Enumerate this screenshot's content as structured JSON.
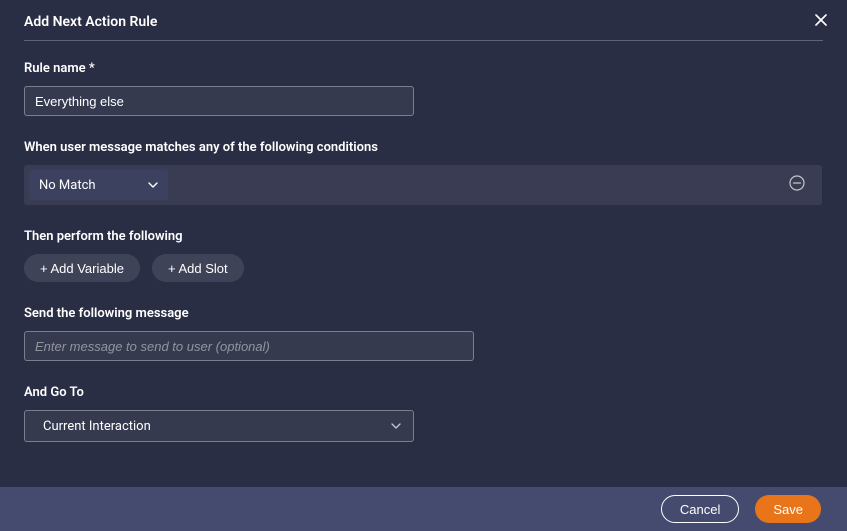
{
  "dialog": {
    "title": "Add Next Action Rule"
  },
  "ruleName": {
    "label": "Rule name *",
    "value": "Everything else"
  },
  "conditions": {
    "label": "When user message matches any of the following conditions",
    "matchType": "No Match"
  },
  "actions": {
    "label": "Then perform the following",
    "addVariable": "+ Add Variable",
    "addSlot": "+ Add Slot"
  },
  "message": {
    "label": "Send the following message",
    "placeholder": "Enter message to send to user (optional)",
    "value": ""
  },
  "goto": {
    "label": "And Go To",
    "value": "Current Interaction"
  },
  "footer": {
    "cancel": "Cancel",
    "save": "Save"
  }
}
